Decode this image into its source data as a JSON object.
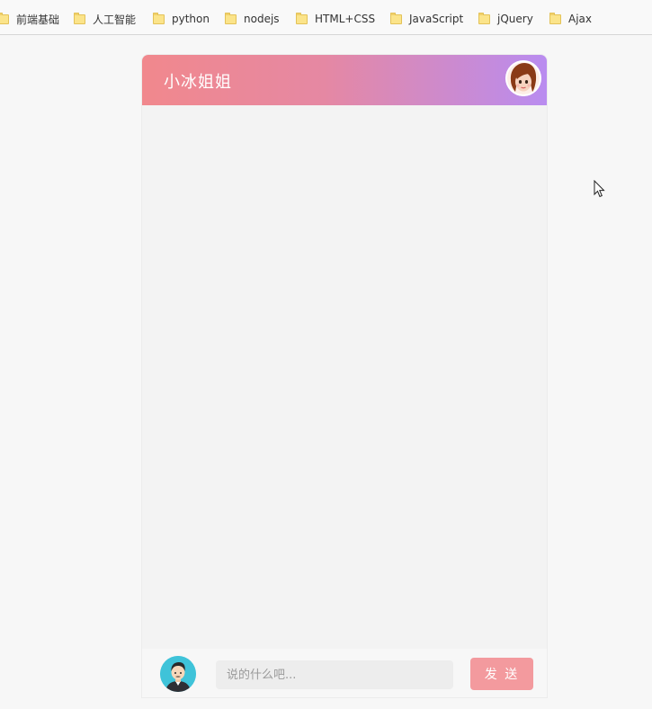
{
  "bookmarks_bar": {
    "items": [
      {
        "label": "前端基础",
        "icon": "folder-icon"
      },
      {
        "label": "人工智能",
        "icon": "folder-icon"
      },
      {
        "label": "python",
        "icon": "folder-icon"
      },
      {
        "label": "nodejs",
        "icon": "folder-icon"
      },
      {
        "label": "HTML+CSS",
        "icon": "folder-icon"
      },
      {
        "label": "JavaScript",
        "icon": "folder-icon"
      },
      {
        "label": "jQuery",
        "icon": "folder-icon"
      },
      {
        "label": "Ajax",
        "icon": "folder-icon"
      }
    ]
  },
  "chat": {
    "title": "小冰姐姐",
    "bot_avatar_icon": "girl-avatar-icon",
    "user_avatar_icon": "man-avatar-icon",
    "input_placeholder": "说的什么吧...",
    "input_value": "",
    "send_label": "发 送",
    "colors": {
      "header_gradient_start": "#f1888d",
      "header_gradient_end": "#b98cf0",
      "send_button": "#f39a9e"
    }
  },
  "cursor_icon": "mouse-pointer-icon"
}
